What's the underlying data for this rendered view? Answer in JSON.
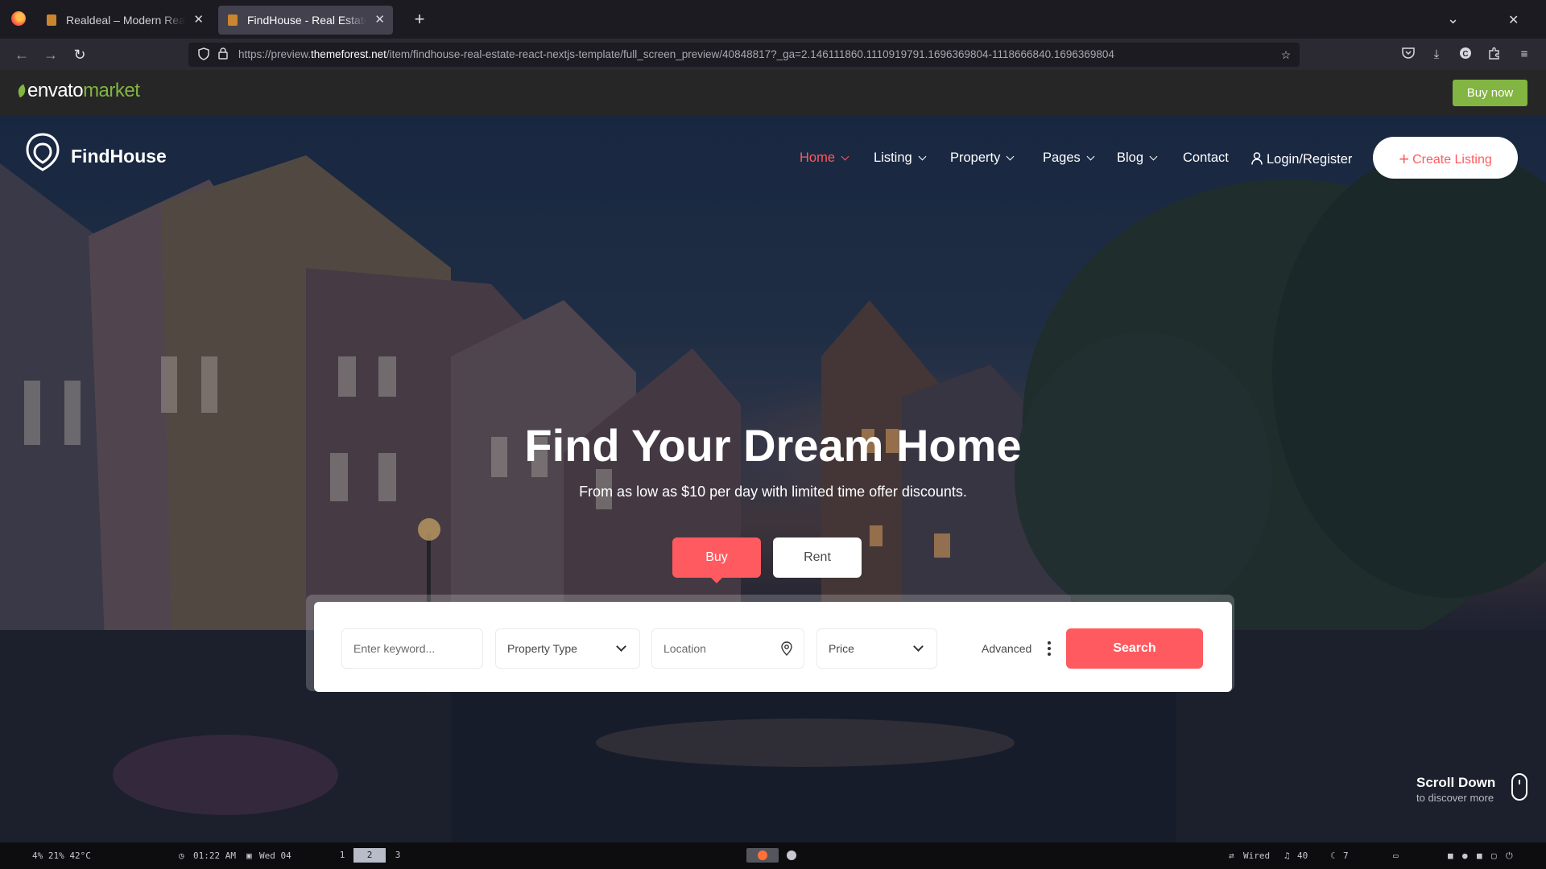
{
  "browser": {
    "tabs": [
      {
        "title": "Realdeal – Modern Real Esta",
        "active": false
      },
      {
        "title": "FindHouse - Real Estate Rea",
        "active": true
      }
    ],
    "url_prefix": "https://preview.",
    "url_domain": "themeforest.net",
    "url_rest": "/item/findhouse-real-estate-react-nextjs-template/full_screen_preview/40848817?_ga=2.146111860.1110919791.1696369804-1118666840.1696369804"
  },
  "envato": {
    "logo_word": "envato",
    "logo_market": "market",
    "buy_now": "Buy now",
    "accent": "#82b541"
  },
  "site": {
    "brand": "FindHouse",
    "accent": "#ff5a5f",
    "nav": [
      {
        "label": "Home",
        "active": true
      },
      {
        "label": "Listing"
      },
      {
        "label": "Property"
      },
      {
        "label": "Pages"
      },
      {
        "label": "Blog"
      },
      {
        "label": "Contact"
      }
    ],
    "login": "Login/Register",
    "create_listing": "Create Listing"
  },
  "hero": {
    "title": "Find Your Dream Home",
    "subtitle": "From as low as $10 per day with limited time offer discounts.",
    "tab_buy": "Buy",
    "tab_rent": "Rent",
    "search": {
      "keyword_placeholder": "Enter keyword...",
      "property_type": "Property Type",
      "location_placeholder": "Location",
      "price": "Price",
      "advanced": "Advanced",
      "button": "Search"
    },
    "scroll_title": "Scroll Down",
    "scroll_sub": "to discover more"
  },
  "statusbar": {
    "sys": "4%  21%  42°C",
    "clock": "01:22 AM",
    "date": "Wed 04",
    "workspaces": [
      "1",
      "2",
      "3"
    ],
    "current_workspace": "2",
    "network": "Wired",
    "volume": "40",
    "brightness": "7"
  }
}
